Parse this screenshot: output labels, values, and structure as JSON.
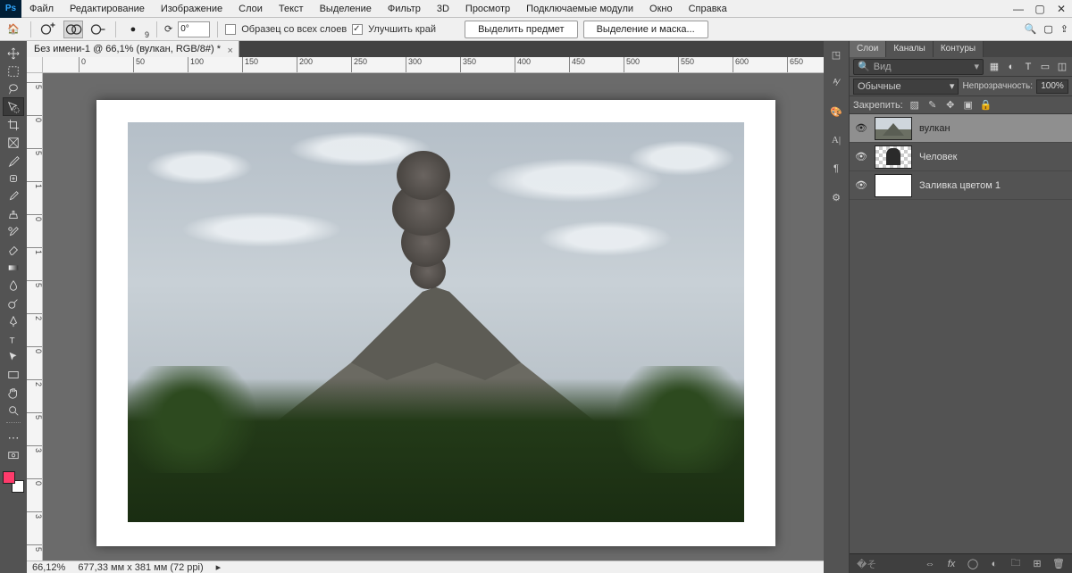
{
  "menu": {
    "items": [
      "Файл",
      "Редактирование",
      "Изображение",
      "Слои",
      "Текст",
      "Выделение",
      "Фильтр",
      "3D",
      "Просмотр",
      "Подключаемые модули",
      "Окно",
      "Справка"
    ]
  },
  "optbar": {
    "size_label": "9",
    "angle_label": "0°",
    "sample_all": "Образец со всех слоев",
    "refine": "Улучшить край",
    "select_subject": "Выделить предмет",
    "select_mask": "Выделение и маска..."
  },
  "doc": {
    "tab": "Без имени-1 @ 66,1% (вулкан, RGB/8#) *"
  },
  "ruler": {
    "h": [
      "0",
      "50",
      "100",
      "150",
      "200",
      "250",
      "300",
      "350",
      "400",
      "450",
      "500",
      "550",
      "600",
      "650"
    ],
    "v": [
      "5",
      "0",
      "5",
      "1",
      "0",
      "1",
      "5",
      "2",
      "0",
      "2",
      "5",
      "3",
      "0",
      "3",
      "5"
    ]
  },
  "status": {
    "zoom": "66,12%",
    "dims": "677,33 мм x 381 мм (72 ppi)"
  },
  "panels": {
    "tabs": [
      "Слои",
      "Каналы",
      "Контуры"
    ],
    "search_placeholder": "Вид",
    "blend": "Обычные",
    "opacity_label": "Непрозрачность:",
    "opacity": "100%",
    "lock_label": "Закрепить:",
    "layers": [
      {
        "name": "вулкан",
        "selected": true,
        "thumb": "volc"
      },
      {
        "name": "Человек",
        "selected": false,
        "thumb": "person"
      },
      {
        "name": "Заливка цветом 1",
        "selected": false,
        "thumb": "fill"
      }
    ],
    "footer_fx": "fx"
  }
}
